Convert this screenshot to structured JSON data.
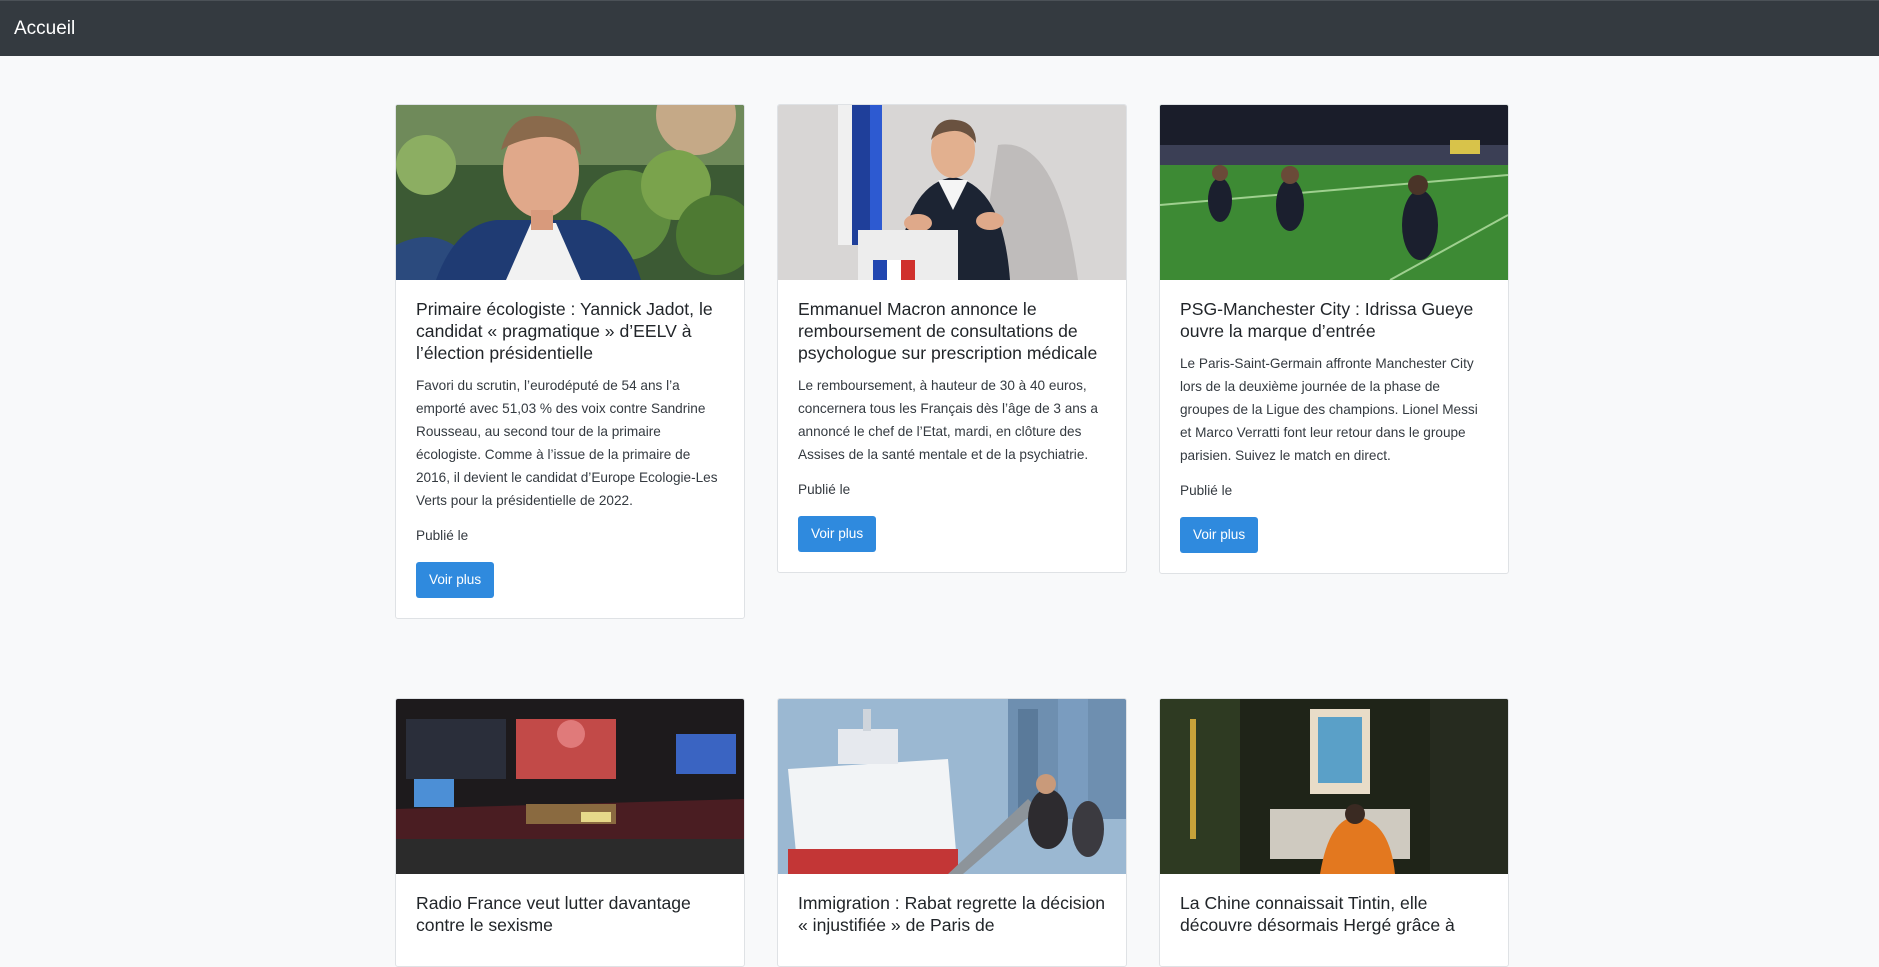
{
  "navbar": {
    "brand": "Accueil"
  },
  "common": {
    "published_label": "Publié le",
    "more_label": "Voir plus"
  },
  "articles": [
    {
      "title": "Primaire écologiste : Yannick Jadot, le candidat « pragmatique » d’EELV à l’élection présidentielle",
      "summary": "Favori du scrutin, l’eurodéputé de 54 ans l’a emporté avec 51,03 % des voix contre Sandrine Rousseau, au second tour de la primaire écologiste. Comme à l’issue de la primaire de 2016, il devient le candidat d’Europe Ecologie-Les Verts pour la présidentielle de 2022.",
      "image": "photo-politician-speaking"
    },
    {
      "title": "Emmanuel Macron annonce le remboursement de consultations de psychologue sur prescription médicale",
      "summary": "Le remboursement, à hauteur de 30 à 40 euros, concernera tous les Français dès l’âge de 3 ans a annoncé le chef de l’Etat, mardi, en clôture des Assises de la santé mentale et de la psychiatrie.",
      "image": "photo-president-podium"
    },
    {
      "title": "PSG-Manchester City : Idrissa Gueye ouvre la marque d’entrée",
      "summary": "Le Paris-Saint-Germain affronte Manchester City lors de la deuxième journée de la phase de groupes de la Ligue des champions. Lionel Messi et Marco Verratti font leur retour dans le groupe parisien. Suivez le match en direct.",
      "image": "photo-football-celebration"
    },
    {
      "title": "Radio France veut lutter davantage contre le sexisme",
      "summary": "",
      "image": "photo-radio-studio"
    },
    {
      "title": "Immigration : Rabat regrette la décision « injustifiée » de Paris de",
      "summary": "",
      "image": "photo-ferry-port"
    },
    {
      "title": "La Chine connaissait Tintin, elle découvre désormais Hergé grâce à",
      "summary": "",
      "image": "photo-street-poster"
    }
  ]
}
